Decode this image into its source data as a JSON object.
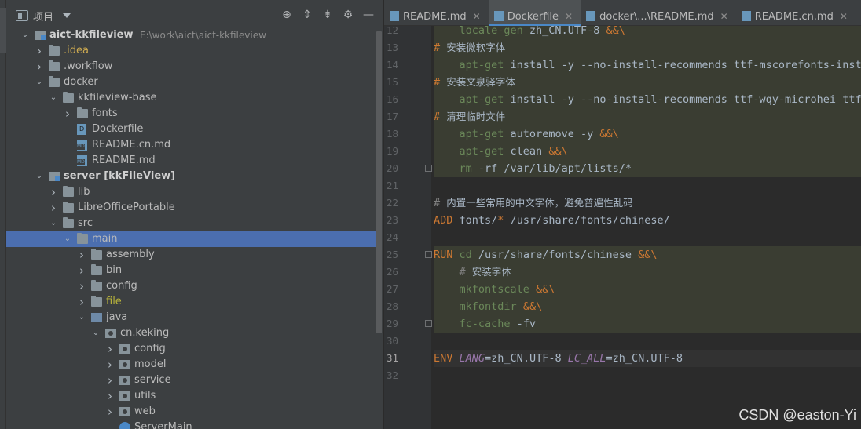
{
  "panel": {
    "title": "项目",
    "tool_icons": [
      "locate-icon",
      "expand-all-icon",
      "collapse-all-icon",
      "settings-icon",
      "hide-icon"
    ]
  },
  "tree": [
    {
      "label": "aict-kkfileview",
      "path": "E:\\work\\aict\\aict-kkfileview",
      "icon": "module",
      "arrow": "down",
      "bold": true
    },
    {
      "label": ".idea",
      "icon": "folder",
      "arrow": "right",
      "style": "dim"
    },
    {
      "label": ".workflow",
      "icon": "folder",
      "arrow": "right"
    },
    {
      "label": "docker",
      "icon": "folder",
      "arrow": "down"
    },
    {
      "label": "kkfileview-base",
      "icon": "folder",
      "arrow": "down"
    },
    {
      "label": "fonts",
      "icon": "folder",
      "arrow": "right"
    },
    {
      "label": "Dockerfile",
      "icon": "file-docker",
      "arrow": ""
    },
    {
      "label": "README.cn.md",
      "icon": "file-md",
      "arrow": ""
    },
    {
      "label": "README.md",
      "icon": "file-md",
      "arrow": ""
    },
    {
      "label": "server [kkFileView]",
      "icon": "module",
      "arrow": "down",
      "bold": true
    },
    {
      "label": "lib",
      "icon": "folder",
      "arrow": "right"
    },
    {
      "label": "LibreOfficePortable",
      "icon": "folder",
      "arrow": "right"
    },
    {
      "label": "src",
      "icon": "folder",
      "arrow": "down"
    },
    {
      "label": "main",
      "icon": "folder",
      "arrow": "down",
      "selected": true
    },
    {
      "label": "assembly",
      "icon": "folder",
      "arrow": "right"
    },
    {
      "label": "bin",
      "icon": "folder",
      "arrow": "right"
    },
    {
      "label": "config",
      "icon": "folder",
      "arrow": "right"
    },
    {
      "label": "file",
      "icon": "folder",
      "arrow": "right",
      "style": "yellow"
    },
    {
      "label": "java",
      "icon": "folder-blue",
      "arrow": "down"
    },
    {
      "label": "cn.keking",
      "icon": "folder-pkg",
      "arrow": "down"
    },
    {
      "label": "config",
      "icon": "folder-pkg",
      "arrow": "right"
    },
    {
      "label": "model",
      "icon": "folder-pkg",
      "arrow": "right"
    },
    {
      "label": "service",
      "icon": "folder-pkg",
      "arrow": "right"
    },
    {
      "label": "utils",
      "icon": "folder-pkg",
      "arrow": "right"
    },
    {
      "label": "web",
      "icon": "folder-pkg",
      "arrow": "right"
    },
    {
      "label": "ServerMain",
      "icon": "file-class",
      "arrow": ""
    }
  ],
  "tabs": [
    {
      "label": "README.md",
      "icon": "markdown-file-icon",
      "active": false
    },
    {
      "label": "Dockerfile",
      "icon": "docker-file-icon",
      "active": true
    },
    {
      "label": "docker\\...\\README.md",
      "icon": "markdown-file-icon",
      "active": false
    },
    {
      "label": "README.cn.md",
      "icon": "markdown-file-icon",
      "active": false
    }
  ],
  "code": [
    {
      "n": "12",
      "hl": true,
      "parts": [
        [
          "",
          "    "
        ],
        [
          "cmd",
          "locale-gen"
        ],
        [
          "",
          " zh_CN.UTF-8 "
        ],
        [
          "kw",
          "&&\\"
        ]
      ]
    },
    {
      "n": "13",
      "hl": true,
      "parts": [
        [
          "kw",
          "# "
        ],
        [
          "zh",
          "安装微软字体"
        ]
      ]
    },
    {
      "n": "14",
      "hl": true,
      "parts": [
        [
          "",
          "    "
        ],
        [
          "cmd",
          "apt-get"
        ],
        [
          "",
          " install -y --no-install-recommends ttf-mscorefonts-insta"
        ]
      ]
    },
    {
      "n": "15",
      "hl": true,
      "parts": [
        [
          "kw",
          "# "
        ],
        [
          "zh",
          "安装文泉驿字体"
        ]
      ]
    },
    {
      "n": "16",
      "hl": true,
      "parts": [
        [
          "",
          "    "
        ],
        [
          "cmd",
          "apt-get"
        ],
        [
          "",
          " install -y --no-install-recommends ttf-wqy-microhei ttf-"
        ]
      ]
    },
    {
      "n": "17",
      "hl": true,
      "parts": [
        [
          "kw",
          "# "
        ],
        [
          "zh",
          "清理临时文件"
        ]
      ]
    },
    {
      "n": "18",
      "hl": true,
      "parts": [
        [
          "",
          "    "
        ],
        [
          "cmd",
          "apt-get"
        ],
        [
          "",
          " autoremove -y "
        ],
        [
          "kw",
          "&&\\"
        ]
      ]
    },
    {
      "n": "19",
      "hl": true,
      "parts": [
        [
          "",
          "    "
        ],
        [
          "cmd",
          "apt-get"
        ],
        [
          "",
          " clean "
        ],
        [
          "kw",
          "&&\\"
        ]
      ]
    },
    {
      "n": "20",
      "hl": true,
      "fold": true,
      "parts": [
        [
          "",
          "    "
        ],
        [
          "cmd",
          "rm"
        ],
        [
          "",
          " -rf /var/lib/apt/lists/*"
        ]
      ]
    },
    {
      "n": "21",
      "parts": [
        [
          "",
          ""
        ]
      ]
    },
    {
      "n": "22",
      "parts": [
        [
          "cm",
          "# "
        ],
        [
          "zh",
          "内置一些常用的中文字体，避免普遍性乱码"
        ]
      ]
    },
    {
      "n": "23",
      "parts": [
        [
          "kw",
          "ADD"
        ],
        [
          "",
          " fonts/"
        ],
        [
          "kw",
          "*"
        ],
        [
          "",
          " /usr/share/fonts/chinese/"
        ]
      ]
    },
    {
      "n": "24",
      "parts": [
        [
          "",
          ""
        ]
      ]
    },
    {
      "n": "25",
      "hl": true,
      "fold": true,
      "parts": [
        [
          "kw",
          "RUN"
        ],
        [
          "",
          " "
        ],
        [
          "cmd",
          "cd"
        ],
        [
          "",
          " /usr/share/fonts/chinese "
        ],
        [
          "kw",
          "&&\\"
        ]
      ]
    },
    {
      "n": "26",
      "hl": true,
      "parts": [
        [
          "",
          "    "
        ],
        [
          "cm",
          "# "
        ],
        [
          "zh",
          "安装字体"
        ]
      ]
    },
    {
      "n": "27",
      "hl": true,
      "parts": [
        [
          "",
          "    "
        ],
        [
          "cmd",
          "mkfontscale"
        ],
        [
          "",
          " "
        ],
        [
          "kw",
          "&&\\"
        ]
      ]
    },
    {
      "n": "28",
      "hl": true,
      "parts": [
        [
          "",
          "    "
        ],
        [
          "cmd",
          "mkfontdir"
        ],
        [
          "",
          " "
        ],
        [
          "kw",
          "&&\\"
        ]
      ]
    },
    {
      "n": "29",
      "hl": true,
      "fold": true,
      "parts": [
        [
          "",
          "    "
        ],
        [
          "cmd",
          "fc-cache"
        ],
        [
          "",
          " -fv"
        ]
      ]
    },
    {
      "n": "30",
      "parts": [
        [
          "",
          ""
        ]
      ]
    },
    {
      "n": "31",
      "caret": true,
      "parts": [
        [
          "kw",
          "ENV"
        ],
        [
          "",
          " "
        ],
        [
          "var",
          "LANG"
        ],
        [
          "",
          "=zh_CN.UTF-8 "
        ],
        [
          "var",
          "LC_ALL"
        ],
        [
          "",
          "=zh_CN.UTF-8"
        ]
      ]
    },
    {
      "n": "32",
      "parts": [
        [
          "",
          ""
        ]
      ]
    }
  ],
  "watermark": "CSDN @easton-Yi",
  "colors": {
    "selection": "#4b6eaf",
    "keyword": "#cc7832",
    "string": "#6a8759",
    "background": "#2b2b2b"
  }
}
